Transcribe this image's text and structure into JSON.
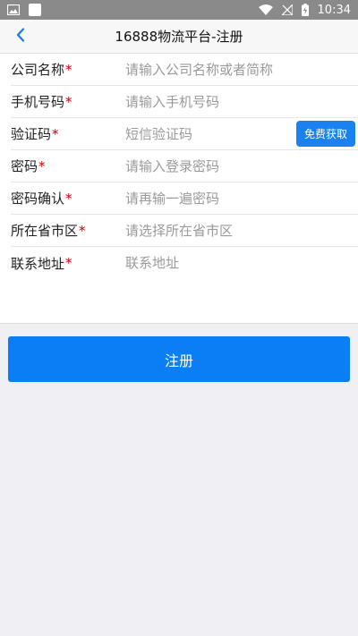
{
  "status_bar": {
    "time": "10:34",
    "icons": [
      "image-icon",
      "square-icon",
      "wifi-icon",
      "no-signal-icon",
      "battery-charging-icon"
    ]
  },
  "nav": {
    "title": "16888物流平台-注册",
    "back_icon": "chevron-left-icon"
  },
  "form": {
    "required_mark": "*",
    "rows": [
      {
        "label": "公司名称",
        "placeholder": "请输入公司名称或者简称"
      },
      {
        "label": "手机号码",
        "placeholder": "请输入手机号码"
      },
      {
        "label": "验证码",
        "placeholder": "短信验证码"
      },
      {
        "label": "密码",
        "placeholder": "请输入登录密码"
      },
      {
        "label": "密码确认",
        "placeholder": "请再输一遍密码"
      },
      {
        "label": "所在省市区",
        "placeholder": "请选择所在省市区"
      },
      {
        "label": "联系地址",
        "placeholder": "联系地址"
      }
    ],
    "code_button_label": "免费获取"
  },
  "register_button_label": "注册",
  "colors": {
    "accent": "#0a7ff5",
    "required": "#d00000",
    "status_bar": "#8a8a8a"
  }
}
